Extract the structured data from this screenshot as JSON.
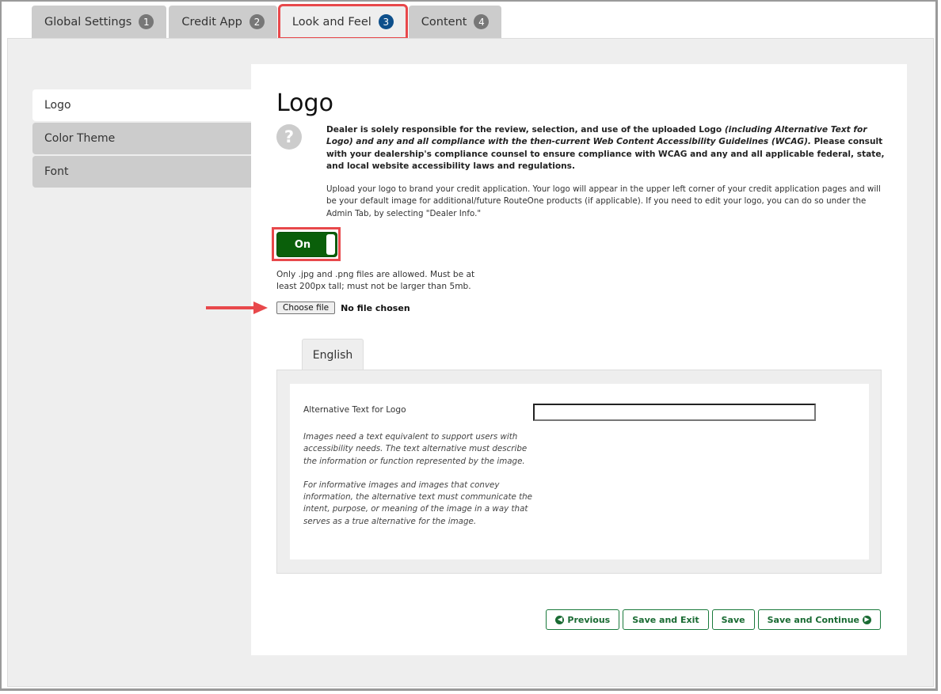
{
  "top_tabs": [
    {
      "label": "Global Settings",
      "badge": "1",
      "active": false
    },
    {
      "label": "Credit App",
      "badge": "2",
      "active": false
    },
    {
      "label": "Look and Feel",
      "badge": "3",
      "active": true
    },
    {
      "label": "Content",
      "badge": "4",
      "active": false
    }
  ],
  "side_nav": [
    {
      "label": "Logo",
      "active": true
    },
    {
      "label": "Color Theme",
      "active": false
    },
    {
      "label": "Font",
      "active": false
    }
  ],
  "main": {
    "title": "Logo",
    "help_icon": "question-circle-icon",
    "disclaimer": {
      "part1": "Dealer is solely responsible for the review, selection, and use of the uploaded Logo ",
      "italic1": "(including Alternative Text for Logo) and any and all compliance with the then-current Web Content Accessibility Guidelines (WCAG).",
      "part2": " Please consult with your dealership's compliance counsel to ensure compliance with WCAG and any and all applicable federal, state, and local website accessibility laws and regulations."
    },
    "upload_description": "Upload your logo to brand your credit application. Your logo will appear in the upper left corner of your credit application pages and will be your default image for additional/future RouteOne products (if applicable). If you need to edit your logo, you can do so under the Admin Tab, by selecting \"Dealer Info.\"",
    "toggle": {
      "label": "On",
      "state": "on",
      "color": "#0a5f0a"
    },
    "file_note": "Only .jpg and .png files are allowed. Must be at least 200px tall; must not be larger than 5mb.",
    "file_input": {
      "button_label": "Choose file",
      "status": "No file chosen"
    },
    "language_tab": "English",
    "alt_text": {
      "label": "Alternative Text for Logo",
      "value": "",
      "help_1": "Images need a text equivalent to support users with accessibility needs. The text alternative must describe the information or function represented by the image.",
      "help_2": "For informative images and images that convey information, the alternative text must communicate the intent, purpose, or meaning of the image in a way that serves as a true alternative for the image."
    }
  },
  "footer": {
    "previous": "Previous",
    "save_and_exit": "Save and Exit",
    "save": "Save",
    "save_and_continue": "Save and Continue"
  },
  "colors": {
    "accent_green": "#1a6b33",
    "highlight_red": "#e8484b",
    "active_badge": "#0d4f8b"
  }
}
